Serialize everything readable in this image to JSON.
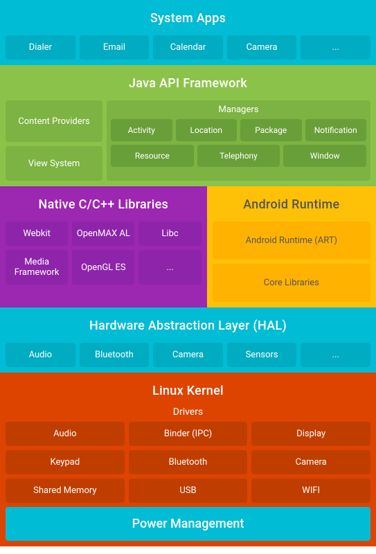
{
  "systemApps": {
    "title": "System Apps",
    "items": [
      "Dialer",
      "Email",
      "Calendar",
      "Camera",
      "..."
    ]
  },
  "javaApi": {
    "title": "Java API Framework",
    "contentProviders": "Content Providers",
    "viewSystem": "View System",
    "managersTitle": "Managers",
    "row1": [
      "Activity",
      "Location",
      "Package",
      "Notification"
    ],
    "row2": [
      "Resource",
      "Telephony",
      "Window"
    ]
  },
  "nativeCpp": {
    "title": "Native C/C++ Libraries",
    "row1": [
      "Webkit",
      "OpenMAX AL",
      "Libc"
    ],
    "row2": [
      "Media Framework",
      "OpenGL ES",
      "..."
    ]
  },
  "androidRuntime": {
    "title": "Android Runtime",
    "item1": "Android Runtime (ART)",
    "item2": "Core Libraries"
  },
  "hal": {
    "title": "Hardware Abstraction Layer (HAL)",
    "items": [
      "Audio",
      "Bluetooth",
      "Camera",
      "Sensors",
      "..."
    ]
  },
  "linuxKernel": {
    "title": "Linux Kernel",
    "driversTitle": "Drivers",
    "row1": [
      "Audio",
      "Binder (IPC)",
      "Display"
    ],
    "row2": [
      "Keypad",
      "Bluetooth",
      "Camera"
    ],
    "row3": [
      "Shared Memory",
      "USB",
      "WIFI"
    ],
    "powerManagement": "Power Management"
  }
}
